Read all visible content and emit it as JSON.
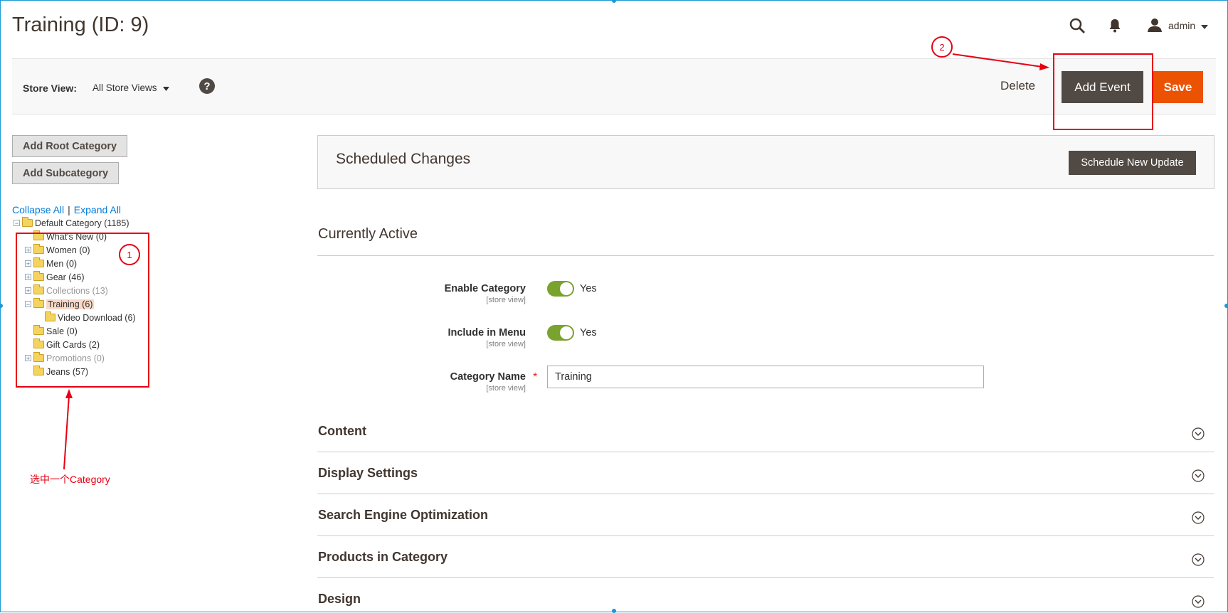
{
  "header": {
    "title": "Training (ID: 9)",
    "user": "admin"
  },
  "toolbar": {
    "store_view_label": "Store View:",
    "store_view_value": "All Store Views",
    "help": "?",
    "delete": "Delete",
    "add_event": "Add Event",
    "save": "Save"
  },
  "sidebar": {
    "add_root": "Add Root Category",
    "add_sub": "Add Subcategory",
    "collapse_all": "Collapse All",
    "separator": "|",
    "expand_all": "Expand All",
    "tree": [
      {
        "label": "Default Category (1185)"
      },
      {
        "label": "What's New (0)"
      },
      {
        "label": "Women (0)"
      },
      {
        "label": "Men (0)"
      },
      {
        "label": "Gear (46)"
      },
      {
        "label": "Collections (13)"
      },
      {
        "label": "Training (6)"
      },
      {
        "label": "Video Download (6)"
      },
      {
        "label": "Sale (0)"
      },
      {
        "label": "Gift Cards (2)"
      },
      {
        "label": "Promotions (0)"
      },
      {
        "label": "Jeans (57)"
      }
    ]
  },
  "annotations": {
    "step1": "1",
    "step2": "2",
    "note": "选中一个Category",
    "color": "#e60012"
  },
  "main": {
    "scheduled_title": "Scheduled Changes",
    "schedule_button": "Schedule New Update",
    "active_title": "Currently Active",
    "fields": {
      "enable_label": "Enable Category",
      "enable_scope": "[store view]",
      "enable_value": "Yes",
      "menu_label": "Include in Menu",
      "menu_scope": "[store view]",
      "menu_value": "Yes",
      "name_label": "Category Name",
      "name_scope": "[store view]",
      "name_required": "*",
      "name_value": "Training"
    },
    "sections": [
      {
        "title": "Content"
      },
      {
        "title": "Display Settings"
      },
      {
        "title": "Search Engine Optimization"
      },
      {
        "title": "Products in Category"
      },
      {
        "title": "Design"
      }
    ]
  },
  "colors": {
    "accent_orange": "#eb5202",
    "dark_button": "#514943",
    "toggle_on": "#79a22e",
    "link": "#007bdb"
  }
}
